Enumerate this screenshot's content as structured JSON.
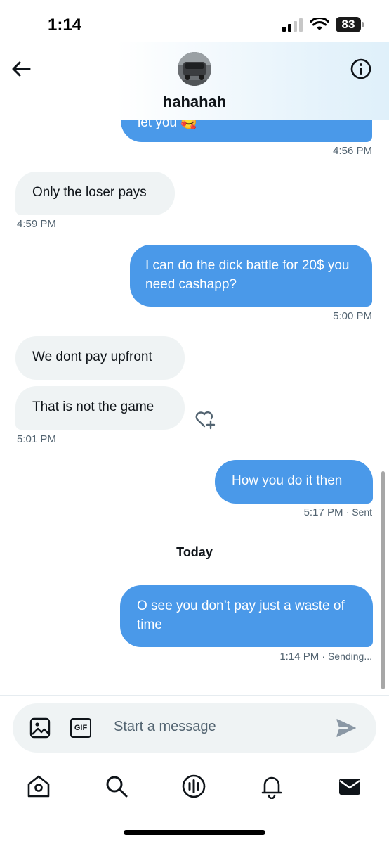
{
  "status_bar": {
    "time": "1:14",
    "battery": "83"
  },
  "header": {
    "name": "hahahah"
  },
  "messages": {
    "m0": {
      "text": "let you 🥰",
      "time": "4:56 PM"
    },
    "m1": {
      "text": "Only the loser pays",
      "time": "4:59 PM"
    },
    "m2": {
      "text": "I can do the dick battle for 20$ you need cashapp?",
      "time": "5:00 PM"
    },
    "m3": {
      "text": "We dont pay upfront"
    },
    "m4": {
      "text": "That is not the game",
      "time": "5:01 PM"
    },
    "m5": {
      "text": "How you do it then",
      "time": "5:17 PM",
      "status": "· Sent"
    },
    "day_separator": "Today",
    "m6": {
      "text": "O see you don’t pay just a waste of time",
      "time": "1:14 PM",
      "status": "· Sending..."
    }
  },
  "composer": {
    "placeholder": "Start a message",
    "gif_label": "GIF"
  },
  "nav": {
    "icons": [
      "home-icon",
      "search-icon",
      "spaces-icon",
      "notifications-icon",
      "messages-icon"
    ]
  },
  "colors": {
    "bubble_out": "#4a99e9",
    "bubble_in": "#eff3f4",
    "text": "#0f1419",
    "meta": "#536471"
  }
}
